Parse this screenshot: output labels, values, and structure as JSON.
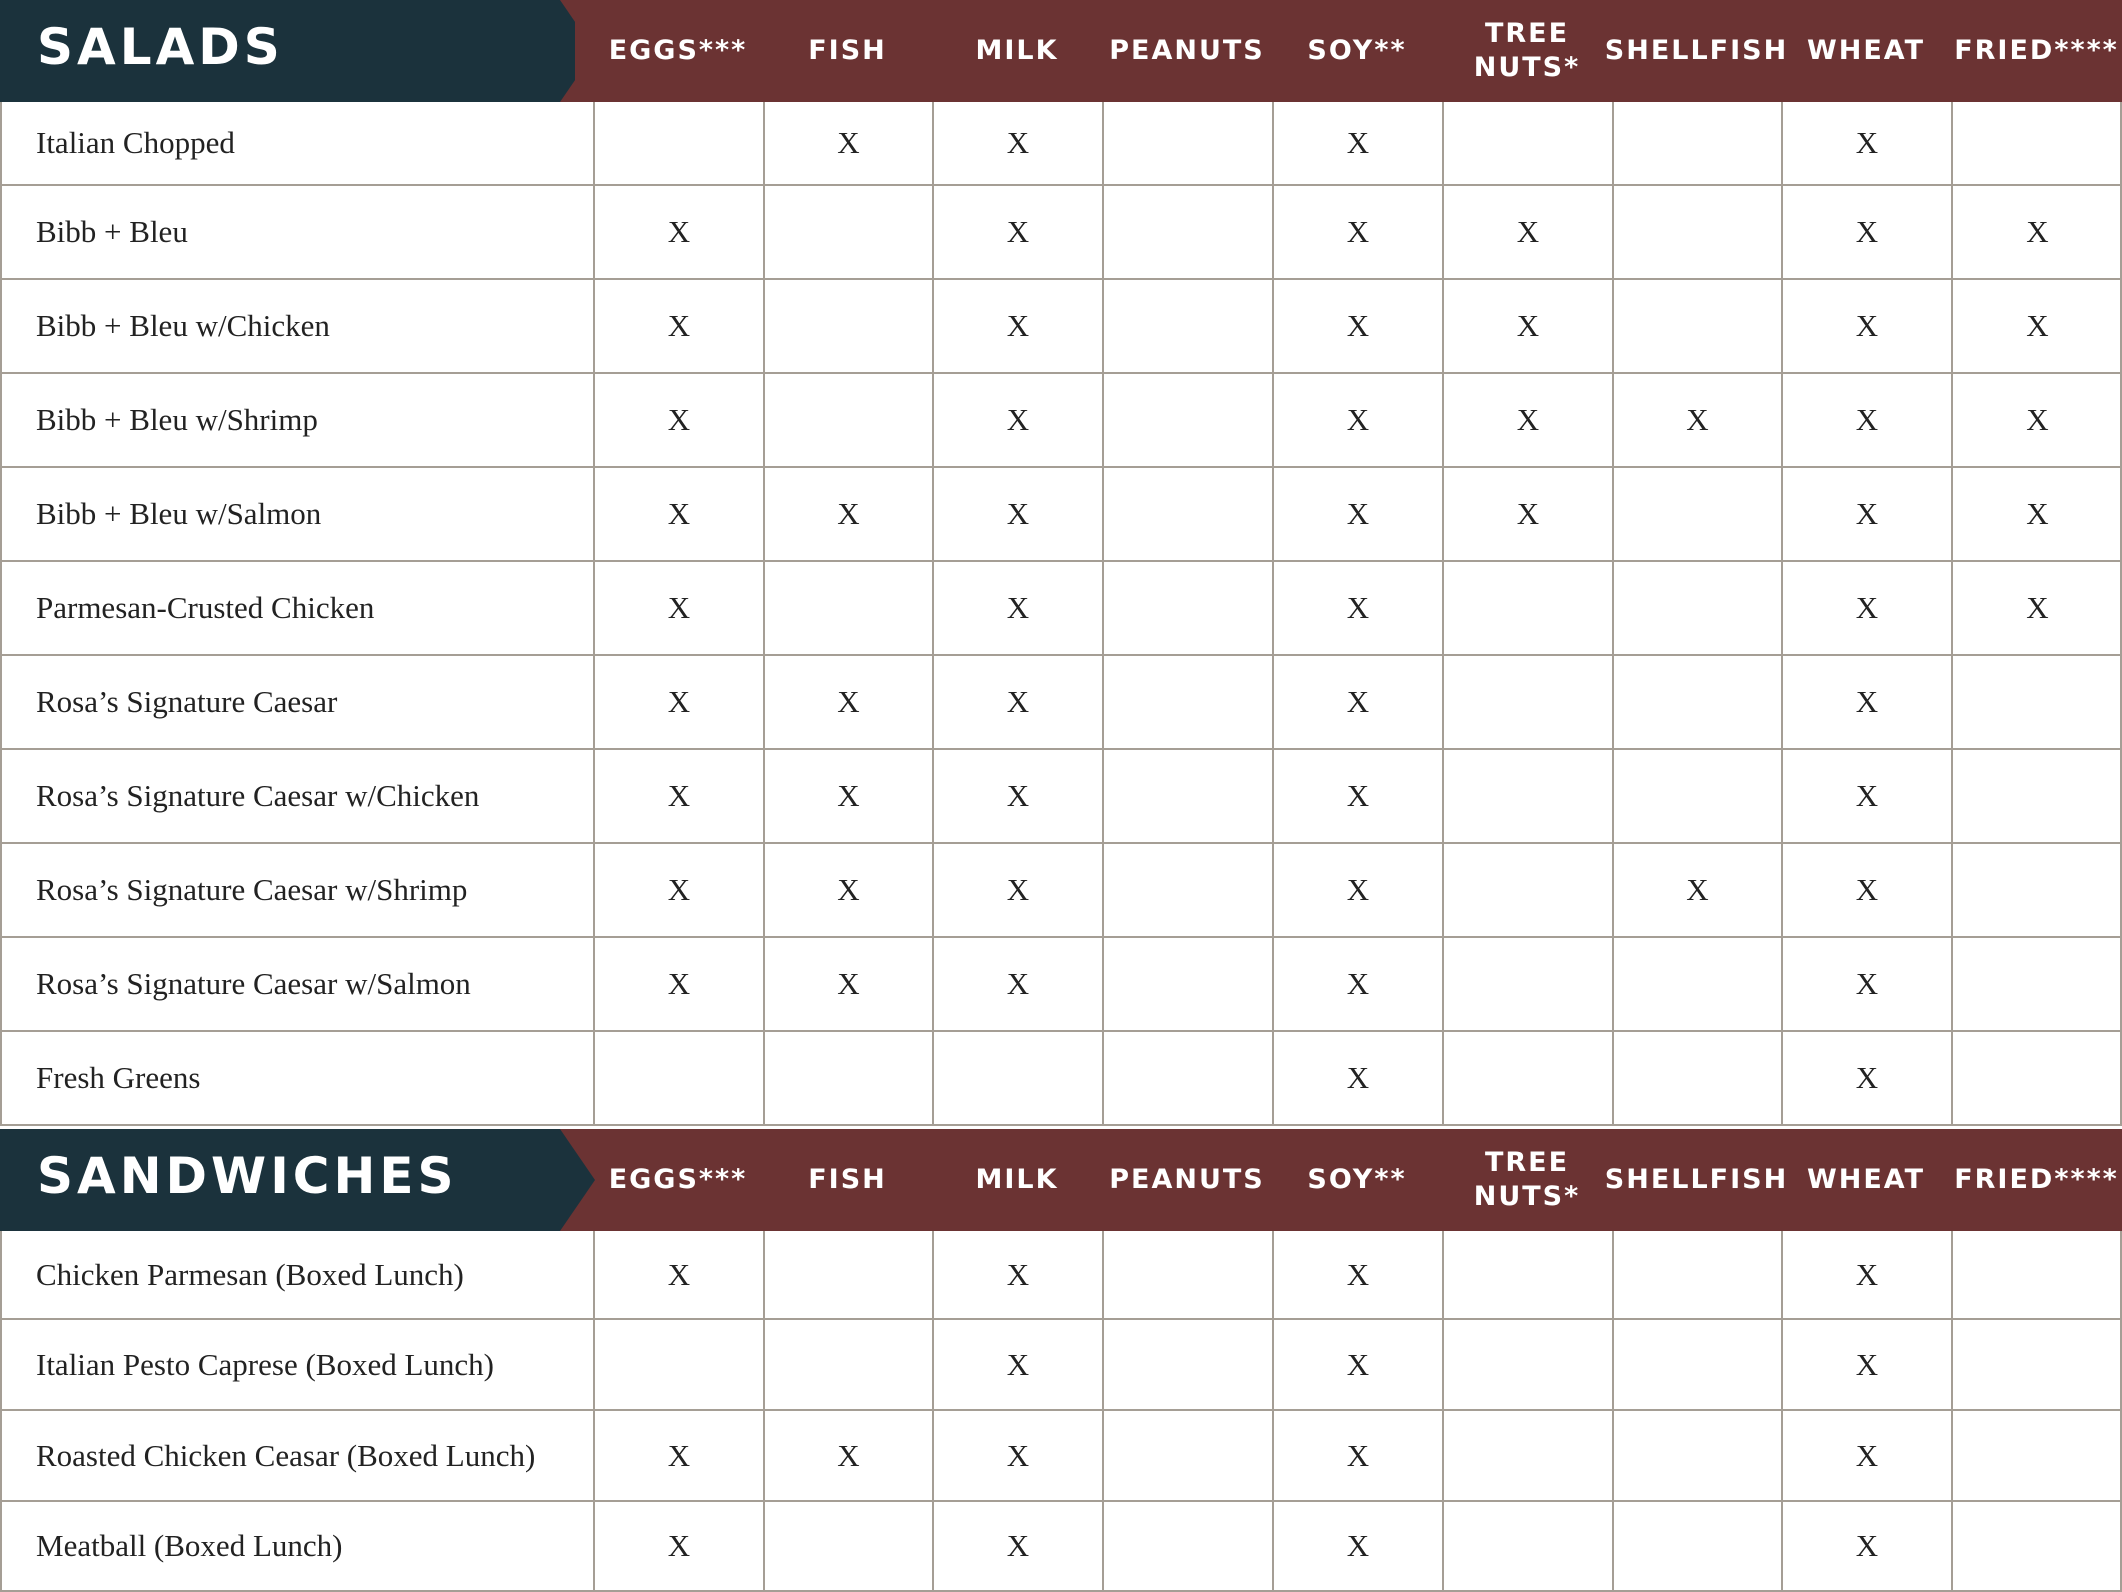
{
  "columns": [
    "EGGS***",
    "FISH",
    "MILK",
    "PEANUTS",
    "SOY**",
    "TREE\nNUTS*",
    "SHELLFISH",
    "WHEAT",
    "FRIED****"
  ],
  "sections": [
    {
      "title": "SALADS",
      "rows": [
        {
          "name": "Italian Chopped",
          "marks": [
            "",
            "X",
            "X",
            "",
            "X",
            "",
            "",
            "X",
            ""
          ]
        },
        {
          "name": "Bibb + Bleu",
          "marks": [
            "X",
            "",
            "X",
            "",
            "X",
            "X",
            "",
            "X",
            "X"
          ]
        },
        {
          "name": "Bibb + Bleu w/Chicken",
          "marks": [
            "X",
            "",
            "X",
            "",
            "X",
            "X",
            "",
            "X",
            "X"
          ]
        },
        {
          "name": "Bibb + Bleu w/Shrimp",
          "marks": [
            "X",
            "",
            "X",
            "",
            "X",
            "X",
            "X",
            "X",
            "X"
          ]
        },
        {
          "name": "Bibb + Bleu w/Salmon",
          "marks": [
            "X",
            "X",
            "X",
            "",
            "X",
            "X",
            "",
            "X",
            "X"
          ]
        },
        {
          "name": "Parmesan-Crusted Chicken",
          "marks": [
            "X",
            "",
            "X",
            "",
            "X",
            "",
            "",
            "X",
            "X"
          ]
        },
        {
          "name": "Rosa’s Signature Caesar",
          "marks": [
            "X",
            "X",
            "X",
            "",
            "X",
            "",
            "",
            "X",
            ""
          ]
        },
        {
          "name": "Rosa’s Signature Caesar w/Chicken",
          "marks": [
            "X",
            "X",
            "X",
            "",
            "X",
            "",
            "",
            "X",
            ""
          ]
        },
        {
          "name": "Rosa’s Signature Caesar w/Shrimp",
          "marks": [
            "X",
            "X",
            "X",
            "",
            "X",
            "",
            "X",
            "X",
            ""
          ]
        },
        {
          "name": "Rosa’s Signature Caesar w/Salmon",
          "marks": [
            "X",
            "X",
            "X",
            "",
            "X",
            "",
            "",
            "X",
            ""
          ]
        },
        {
          "name": "Fresh Greens",
          "marks": [
            "",
            "",
            "",
            "",
            "X",
            "",
            "",
            "X",
            ""
          ]
        }
      ]
    },
    {
      "title": "SANDWICHES",
      "rows": [
        {
          "name": "Chicken Parmesan (Boxed Lunch)",
          "marks": [
            "X",
            "",
            "X",
            "",
            "X",
            "",
            "",
            "X",
            ""
          ]
        },
        {
          "name": "Italian Pesto Caprese (Boxed Lunch)",
          "marks": [
            "",
            "",
            "X",
            "",
            "X",
            "",
            "",
            "X",
            ""
          ]
        },
        {
          "name": "Roasted Chicken Ceasar (Boxed Lunch)",
          "marks": [
            "X",
            "X",
            "X",
            "",
            "X",
            "",
            "",
            "X",
            ""
          ]
        },
        {
          "name": "Meatball (Boxed Lunch)",
          "marks": [
            "X",
            "",
            "X",
            "",
            "X",
            "",
            "",
            "X",
            ""
          ]
        }
      ]
    }
  ]
}
